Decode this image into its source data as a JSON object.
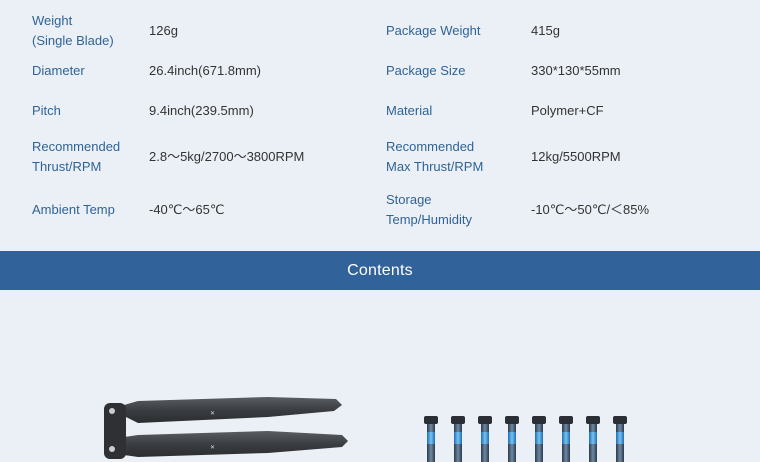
{
  "specs": {
    "rows": [
      {
        "left_label": "Weight\n(Single Blade)",
        "left_value": "126g",
        "right_label": "Package Weight",
        "right_value": "415g"
      },
      {
        "left_label": "Diameter",
        "left_value": "26.4inch(671.8mm)",
        "right_label": "Package Size",
        "right_value": "330*130*55mm"
      },
      {
        "left_label": "Pitch",
        "left_value": "9.4inch(239.5mm)",
        "right_label": "Material",
        "right_value": "Polymer+CF"
      },
      {
        "left_label": "Recommended\nThrust/RPM",
        "left_value": "2.8～5kg/2700～3800RPM",
        "right_label": "Recommended\nMax Thrust/RPM",
        "right_value": "12kg/5500RPM"
      },
      {
        "left_label": "Ambient Temp",
        "left_value": "-40℃～65℃",
        "right_label": "Storage\nTemp/Humidity",
        "right_value": "-10℃～50℃/＜85%"
      }
    ]
  },
  "contents": {
    "title": "Contents",
    "items": [
      "propeller-blades-image",
      "screws-image"
    ]
  },
  "colors": {
    "background": "#ebf0f6",
    "label": "#2f6397",
    "value": "#333333",
    "banner": "#31639a"
  }
}
